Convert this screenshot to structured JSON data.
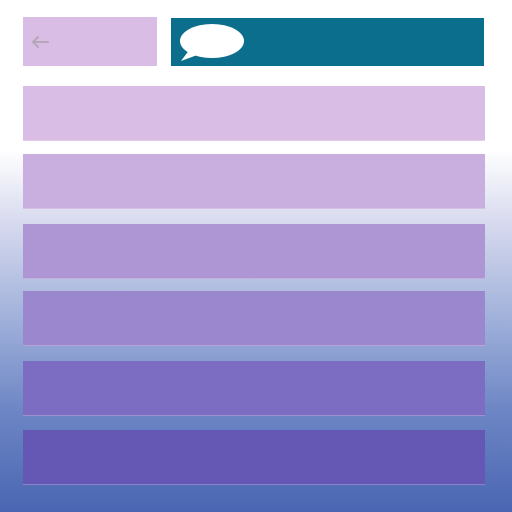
{
  "header": {
    "back_icon": "arrow-left-icon",
    "chat_icon": "speech-bubble-icon",
    "title": "",
    "colors": {
      "back_panel": "#d9bde4",
      "header_bar": "#0c6e8d",
      "chat_bubble": "#ffffff"
    }
  },
  "list": {
    "items": [
      {
        "label": "",
        "color": "#d9bde4"
      },
      {
        "label": "",
        "color": "#c9aee0"
      },
      {
        "label": "",
        "color": "#ae96d4"
      },
      {
        "label": "",
        "color": "#9b87ce"
      },
      {
        "label": "",
        "color": "#7c6cc2"
      },
      {
        "label": "",
        "color": "#6558b4"
      }
    ]
  }
}
